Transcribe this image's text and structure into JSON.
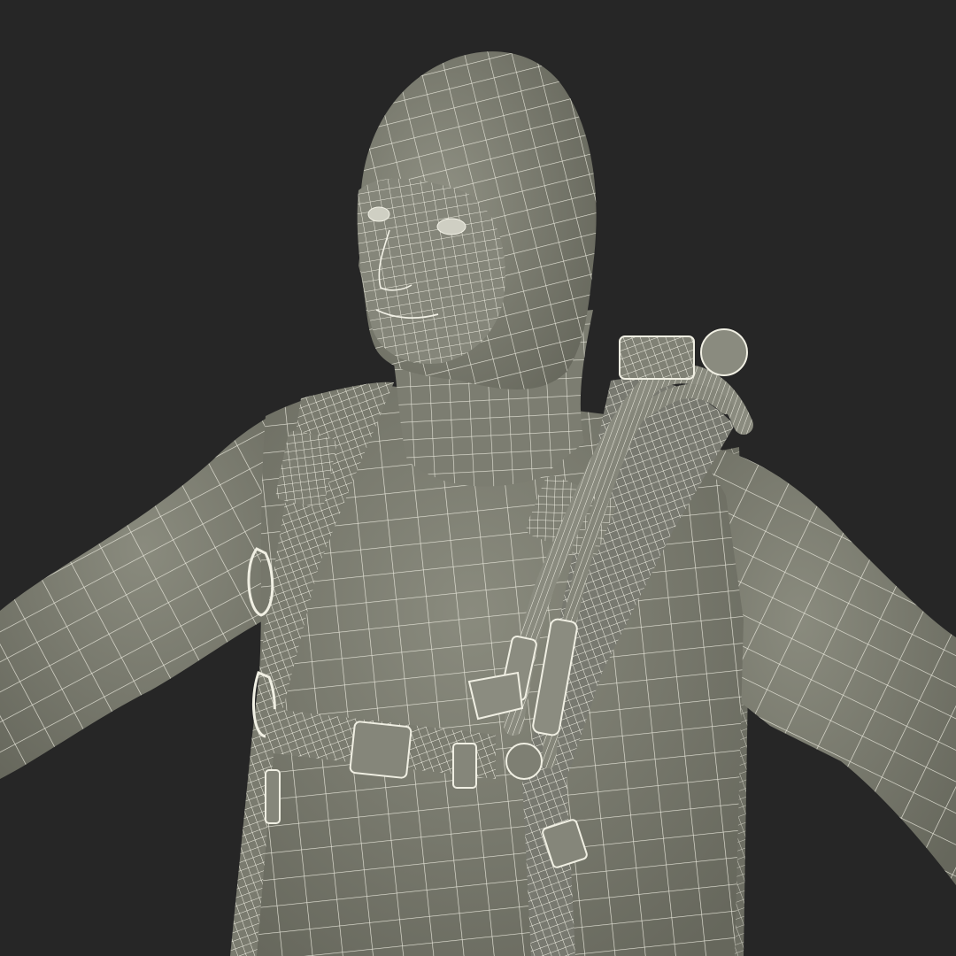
{
  "scene": {
    "subject": "wireframe-figure",
    "colors": {
      "background": "#262626",
      "surface": "#7e7f72",
      "surface_dark": "#5f6056",
      "surface_light": "#9a9b8e",
      "wire": "#e9e8dc",
      "wire_dense": "#f2f1e6"
    }
  }
}
